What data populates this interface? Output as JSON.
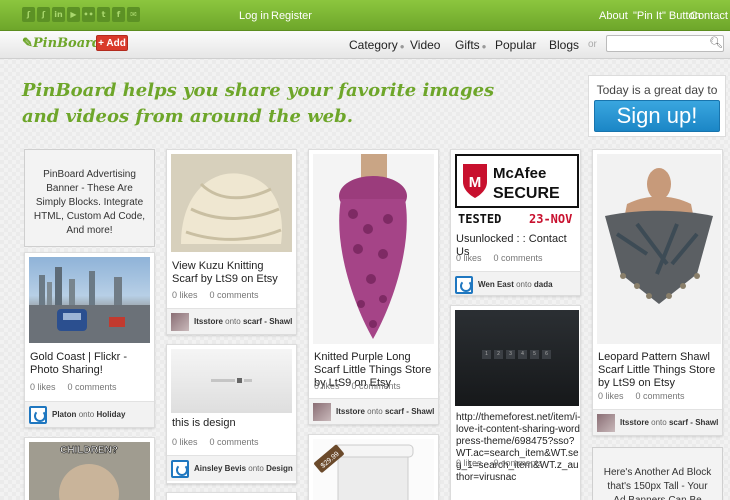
{
  "topbar": {
    "social_icons": [
      "rss-icon",
      "rss-icon",
      "video-icon",
      "youtube-icon",
      "flickr-icon",
      "tumblr-icon",
      "facebook-icon",
      "email-icon"
    ],
    "social_glyphs": [
      "ʃ",
      "ʃ",
      "in",
      "▶",
      "••",
      "t",
      "f",
      "✉"
    ],
    "login": "Log in",
    "register": "Register",
    "about": "About",
    "pin_it": "\"Pin It\" Button",
    "contact": "Contact"
  },
  "nav": {
    "logo": "PinBoard",
    "add_button": "+ Add",
    "category": "Category",
    "video": "Video",
    "gifts": "Gifts",
    "popular": "Popular",
    "blogs": "Blogs",
    "or": "or",
    "search_placeholder": ""
  },
  "hero": {
    "line1": "PinBoard helps you share your favorite images",
    "line2": "and videos from around the web."
  },
  "signup": {
    "text": "Today is a great day to",
    "button": "Sign up!"
  },
  "ads": {
    "top": "PinBoard Advertising Banner - These Are Simply Blocks. Integrate HTML, Custom Ad Code, And more!",
    "bottom": "Here's Another Ad Block that's 150px Tall - Your Ad Banners Can Be"
  },
  "pins": [
    {
      "desc": "Gold Coast | Flickr - Photo Sharing!",
      "likes": "0 likes",
      "comments": "0 comments",
      "user": "Platon",
      "onto": "onto",
      "board": "Holiday"
    },
    {
      "desc": "View Kuzu Knitting Scarf by LtS9 on Etsy",
      "likes": "0 likes",
      "comments": "0 comments",
      "user": "Itsstore",
      "onto": "onto",
      "board": "scarf - Shawl"
    },
    {
      "desc": "this is design",
      "likes": "0 likes",
      "comments": "0 comments",
      "user": "Ainsley Bevis",
      "onto": "onto",
      "board": "Design"
    },
    {
      "desc": "Knitted Purple Long Scarf Little Things Store by LtS9 on Etsy",
      "likes": "0 likes",
      "comments": "0 comments",
      "user": "Itsstore",
      "onto": "onto",
      "board": "scarf - Shawl"
    },
    {
      "desc": "Usunlocked : : Contact Us",
      "likes": "0 likes",
      "comments": "0 comments",
      "user": "Wen East",
      "onto": "onto",
      "board": "dada"
    },
    {
      "desc": "http://themeforest.net/item/i-love-it-content-sharing-wordpress-theme/698475?sso?WT.ac=search_item&WT.seg_1=search_item&WT.z_author=virusnac",
      "likes": "0 likes",
      "comments": "0 comments"
    },
    {
      "desc": "Leopard Pattern Shawl Scarf Little Things Store by LtS9 on Etsy",
      "likes": "0 likes",
      "comments": "0 comments",
      "user": "Itsstore",
      "onto": "onto",
      "board": "scarf - Shawl"
    }
  ],
  "images": {
    "mcafee_brand": "McAfee",
    "mcafee_secure": "SECURE",
    "mcafee_tested": "TESTED",
    "mcafee_date": "23-NOV",
    "meme_text": "CHILDREN?",
    "price_tag": "$29.99",
    "slider_dots": [
      "1",
      "2",
      "3",
      "4",
      "5",
      "6"
    ]
  },
  "colors": {
    "green": "#6ea62a",
    "topbar": "#8cc63e",
    "add_red": "#d93a2b",
    "signup_blue": "#1b86c6"
  }
}
